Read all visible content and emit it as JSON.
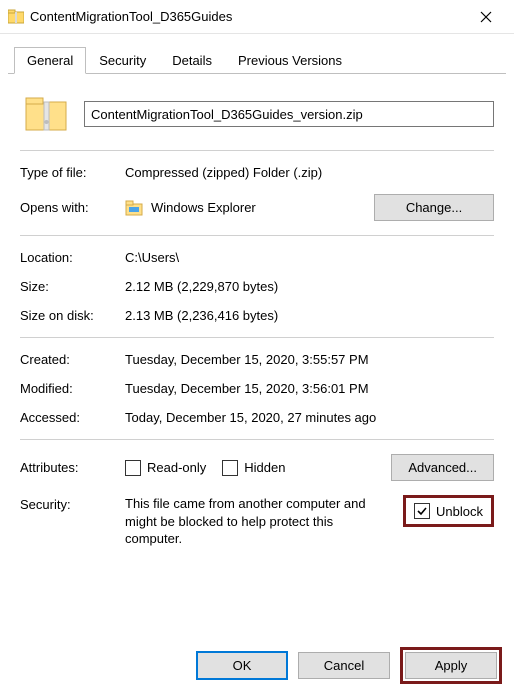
{
  "window": {
    "title": "ContentMigrationTool_D365Guides"
  },
  "tabs": {
    "general": "General",
    "security": "Security",
    "details": "Details",
    "previous_versions": "Previous Versions"
  },
  "file": {
    "name": "ContentMigrationTool_D365Guides_version.zip"
  },
  "labels": {
    "type_of_file": "Type of file:",
    "opens_with": "Opens with:",
    "location": "Location:",
    "size": "Size:",
    "size_on_disk": "Size on disk:",
    "created": "Created:",
    "modified": "Modified:",
    "accessed": "Accessed:",
    "attributes": "Attributes:",
    "security": "Security:"
  },
  "values": {
    "type_of_file": "Compressed (zipped) Folder (.zip)",
    "opens_with": "Windows Explorer",
    "location": "C:\\Users\\",
    "size": "2.12 MB (2,229,870 bytes)",
    "size_on_disk": "2.13 MB (2,236,416 bytes)",
    "created": "Tuesday, December 15, 2020, 3:55:57 PM",
    "modified": "Tuesday, December 15, 2020, 3:56:01 PM",
    "accessed": "Today, December 15, 2020, 27 minutes ago"
  },
  "attributes": {
    "read_only_label": "Read-only",
    "hidden_label": "Hidden"
  },
  "buttons": {
    "change": "Change...",
    "advanced": "Advanced...",
    "ok": "OK",
    "cancel": "Cancel",
    "apply": "Apply"
  },
  "security": {
    "text": "This file came from another computer and might be blocked to help protect this computer.",
    "unblock_label": "Unblock"
  }
}
